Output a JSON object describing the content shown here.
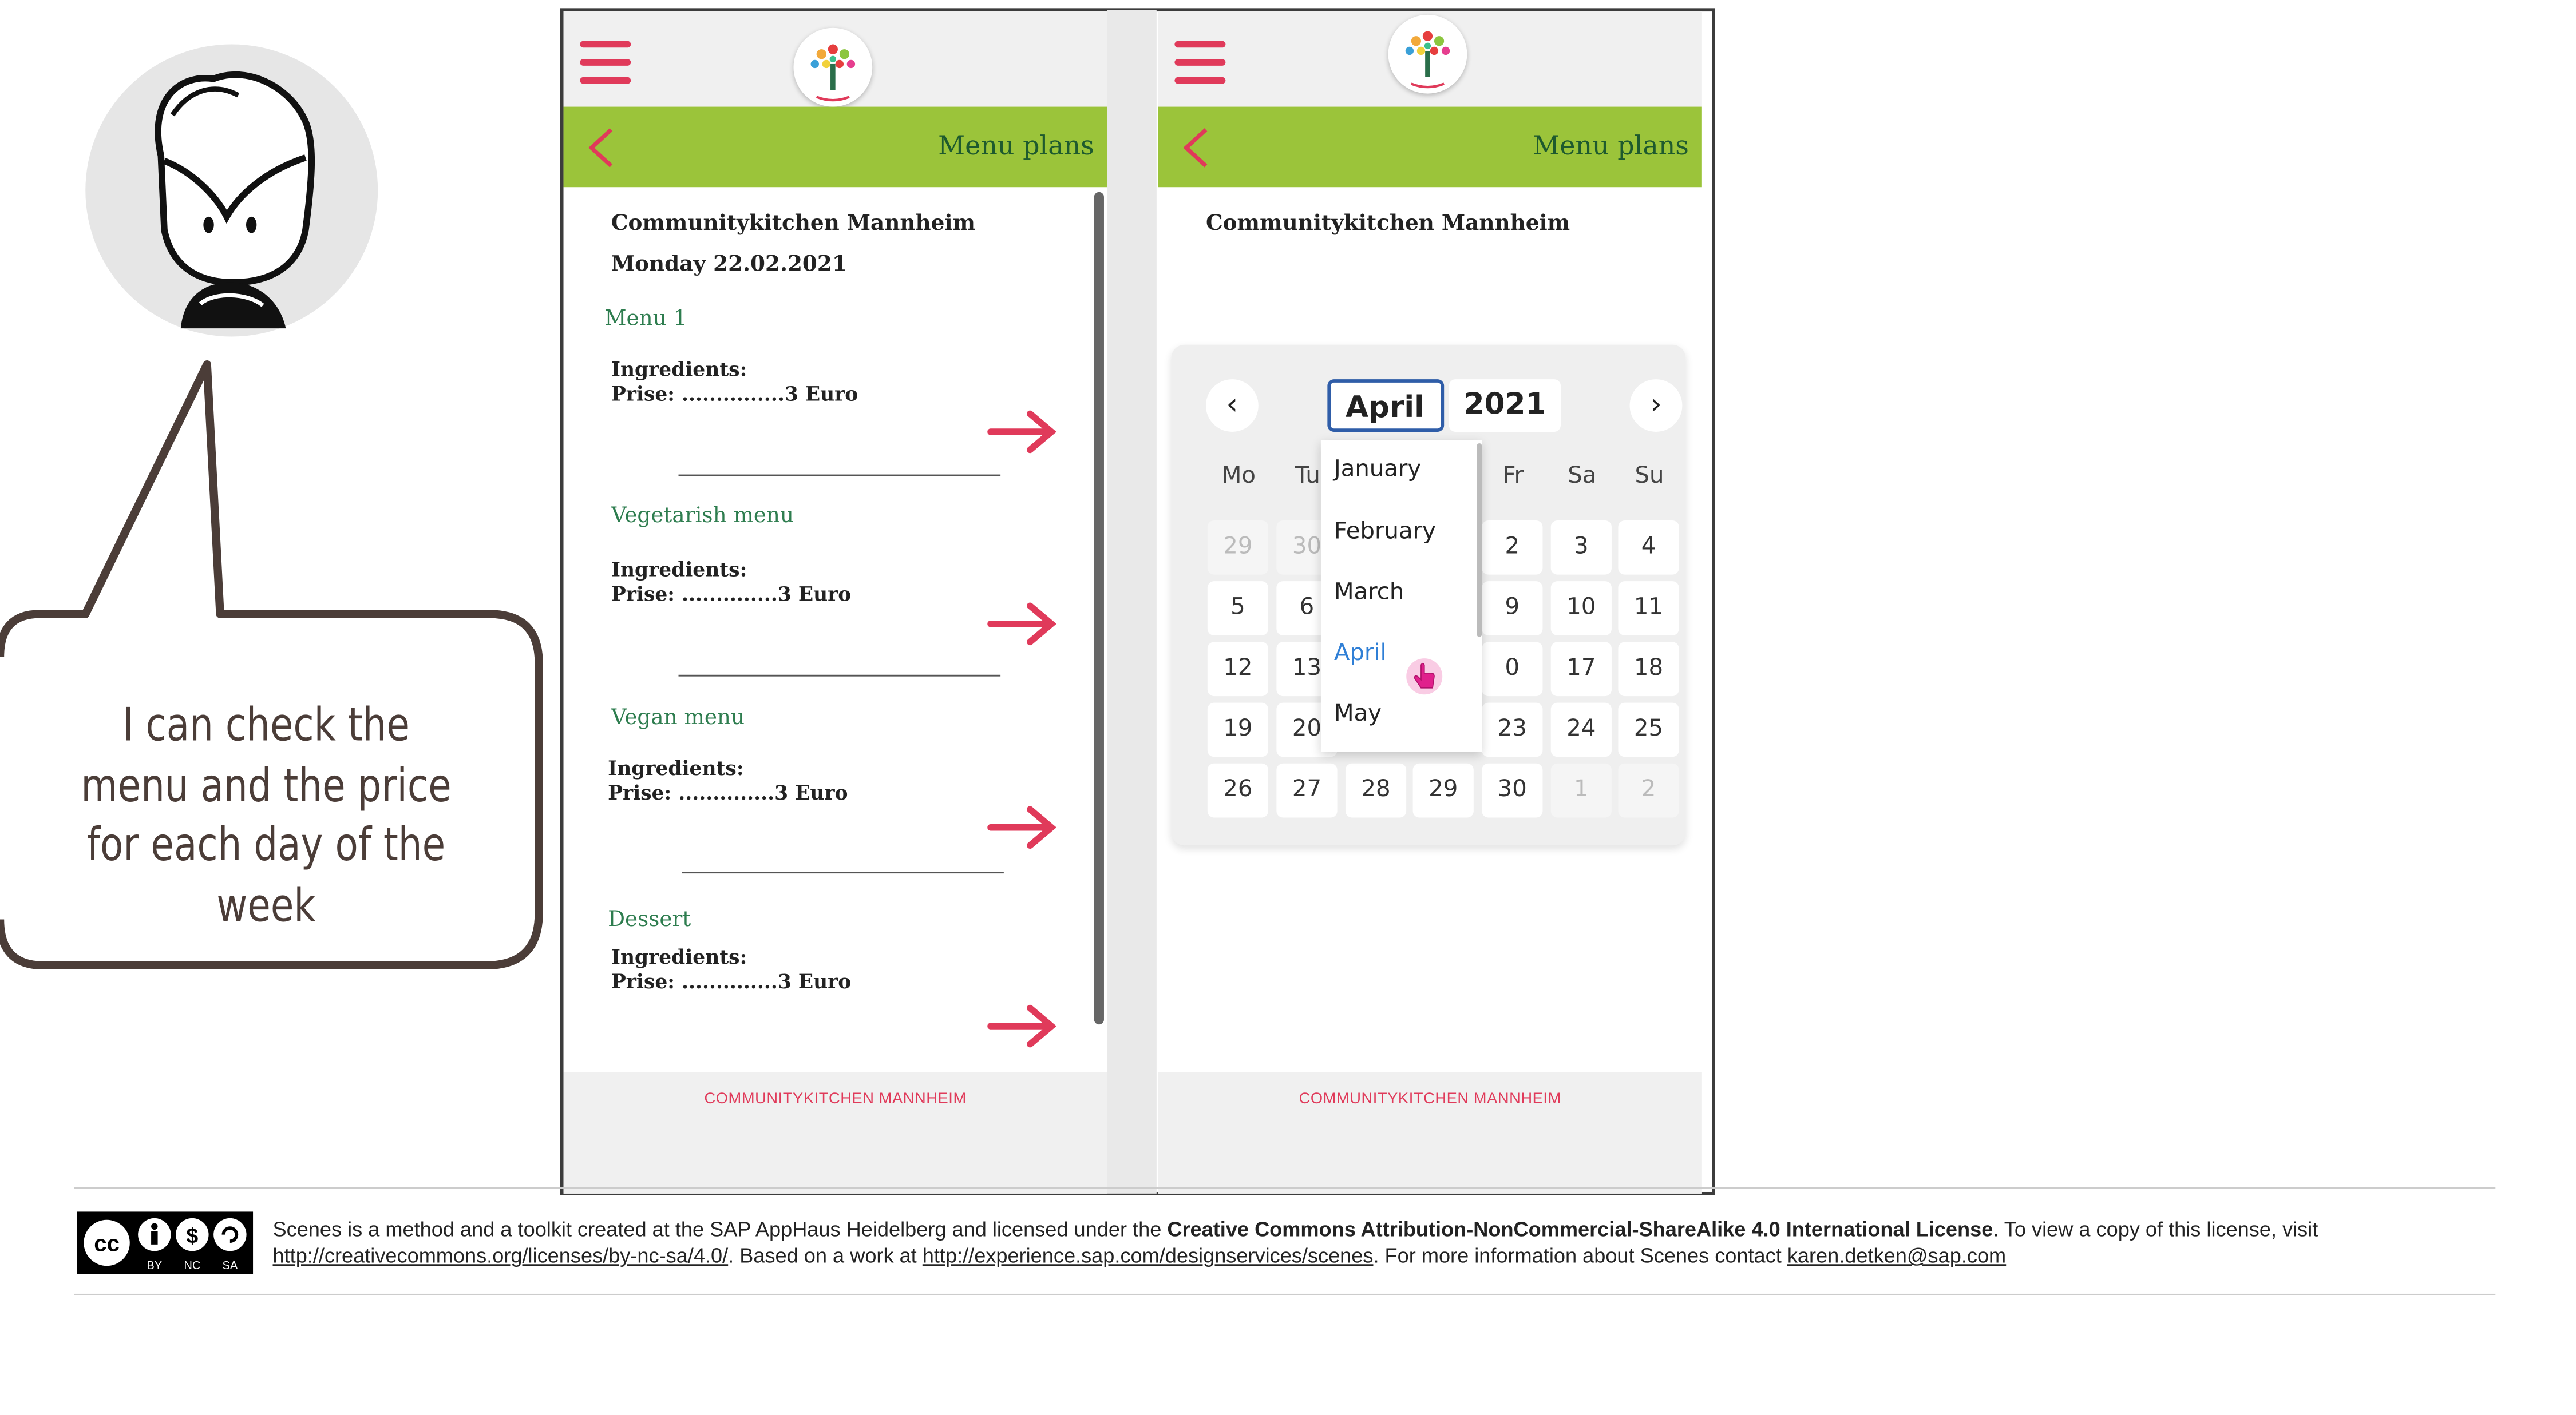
{
  "bubble": {
    "text": "I can check the menu and the price for each day of the week"
  },
  "left_screen": {
    "title": "Menu plans",
    "kitchen": "Communitykitchen Mannheim",
    "date": "Monday 22.02.2021",
    "menus": [
      {
        "name": "Menu 1",
        "ingredients": "Ingredients:",
        "price": "Prise: ...............3 Euro"
      },
      {
        "name": "Vegetarish menu",
        "ingredients": "Ingredients:",
        "price": "Prise: ..............3 Euro"
      },
      {
        "name": "Vegan menu",
        "ingredients": "Ingredients:",
        "price": "Prise: ..............3 Euro"
      },
      {
        "name": "Dessert",
        "ingredients": "Ingredients:",
        "price": "Prise: ..............3 Euro"
      }
    ],
    "footer": "COMMUNITYKITCHEN MANNHEIM"
  },
  "right_screen": {
    "title": "Menu plans",
    "kitchen": "Communitykitchen Mannheim",
    "footer": "COMMUNITYKITCHEN MANNHEIM",
    "datepicker": {
      "month": "April",
      "year": "2021",
      "weekdays": [
        "Mo",
        "Tu",
        "Fr",
        "Sa",
        "Su"
      ],
      "rows": [
        [
          "29",
          "30",
          "2",
          "3",
          "4"
        ],
        [
          "5",
          "6",
          "9",
          "10",
          "11"
        ],
        [
          "12",
          "13",
          "0",
          "17",
          "18"
        ],
        [
          "19",
          "20",
          "23",
          "24",
          "25"
        ],
        [
          "26",
          "27",
          "28",
          "29",
          "30",
          "1",
          "2"
        ]
      ],
      "month_options": [
        "January",
        "February",
        "March",
        "April",
        "May"
      ],
      "selected_month": "April"
    }
  },
  "license": {
    "part1": "Scenes is a method and a toolkit created at the SAP AppHaus Heidelberg and licensed under the ",
    "bold": "Creative Commons Attribution-NonCommercial-ShareAlike 4.0 International License",
    "part2": ". To view a copy of this license, visit ",
    "link1": "http://creativecommons.org/licenses/by-nc-sa/4.0/",
    "part3": ". Based on a work at ",
    "link2": "http://experience.sap.com/designservices/scenes",
    "part4": ". For more information about Scenes contact ",
    "email": "karen.detken@sap.com",
    "badge": {
      "cc": "cc",
      "labels": [
        "BY",
        "NC",
        "SA"
      ]
    }
  },
  "colors": {
    "accent_green": "#9bc43a",
    "accent_red": "#e03a5a",
    "title_green": "#1e5a2e",
    "menu_green": "#2e7d4f",
    "selected_blue": "#2f7fd6"
  }
}
